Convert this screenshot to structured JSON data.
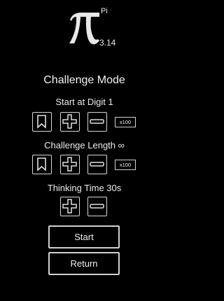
{
  "logo": {
    "superscript": "Pi",
    "value": "3.14",
    "symbol_icon": "pi-icon"
  },
  "screen": {
    "title": "Challenge Mode"
  },
  "start_digit": {
    "label": "Start at Digit 1",
    "multiplier": "x100"
  },
  "challenge_length": {
    "label": "Challenge Length ∞",
    "multiplier": "x100"
  },
  "thinking_time": {
    "label": "Thinking Time 30s"
  },
  "buttons": {
    "start": "Start",
    "return": "Return"
  },
  "colors": {
    "background": "#000000",
    "foreground": "#ffffff",
    "border": "#d8d8d8"
  }
}
